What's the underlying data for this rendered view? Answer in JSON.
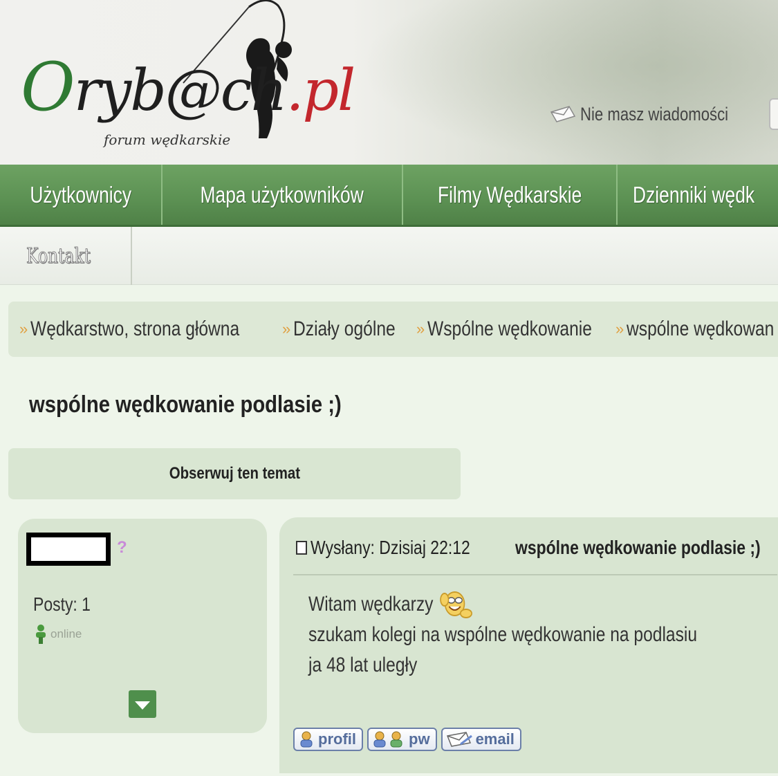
{
  "header": {
    "logo_text": {
      "o": "O",
      "main": "ryb@ch",
      "tld": ".pl"
    },
    "logo_subtitle": "forum wędkarskie",
    "messages_text": "Nie masz wiadomości"
  },
  "nav": {
    "items": [
      {
        "label": "Użytkownicy"
      },
      {
        "label": "Mapa użytkowników"
      },
      {
        "label": "Filmy Wędkarskie"
      },
      {
        "label": "Dzienniki wędk"
      }
    ],
    "sub_items": [
      {
        "label": "Kontakt"
      }
    ]
  },
  "breadcrumb": [
    {
      "label": "Wędkarstwo, strona główna"
    },
    {
      "label": "Działy ogólne"
    },
    {
      "label": "Wspólne wędkowanie"
    },
    {
      "label": "wspólne wędkowan"
    }
  ],
  "topic": {
    "title": "wspólne wędkowanie podlasie ;)",
    "watch_label": "Obserwuj ten temat"
  },
  "user": {
    "posts_label": "Posty: 1",
    "status": "online",
    "gender_symbol": "?"
  },
  "post": {
    "date": "Wysłany: Dzisiaj 22:12",
    "subject": "wspólne wędkowanie podlasie ;)",
    "lines": [
      "Witam wędkarzy",
      "szukam kolegi na wspólne wędkowanie na podlasiu",
      "ja 48 lat uległy"
    ],
    "actions": [
      {
        "label": "profil"
      },
      {
        "label": "pw"
      },
      {
        "label": "email"
      }
    ]
  },
  "colors": {
    "nav_green": "#5d9254",
    "panel_bg": "#d8e5d1",
    "page_bg": "#eef5ea",
    "breadcrumb_sep": "#e0a040",
    "logo_red": "#c3272d",
    "logo_green": "#2f7a33"
  },
  "icons": [
    "fishing-angler-icon",
    "envelope-icon",
    "doc-icon",
    "online-user-icon",
    "smiley-wave-icon",
    "profile-icon",
    "pm-icon",
    "email-icon",
    "chevron-down-icon"
  ]
}
